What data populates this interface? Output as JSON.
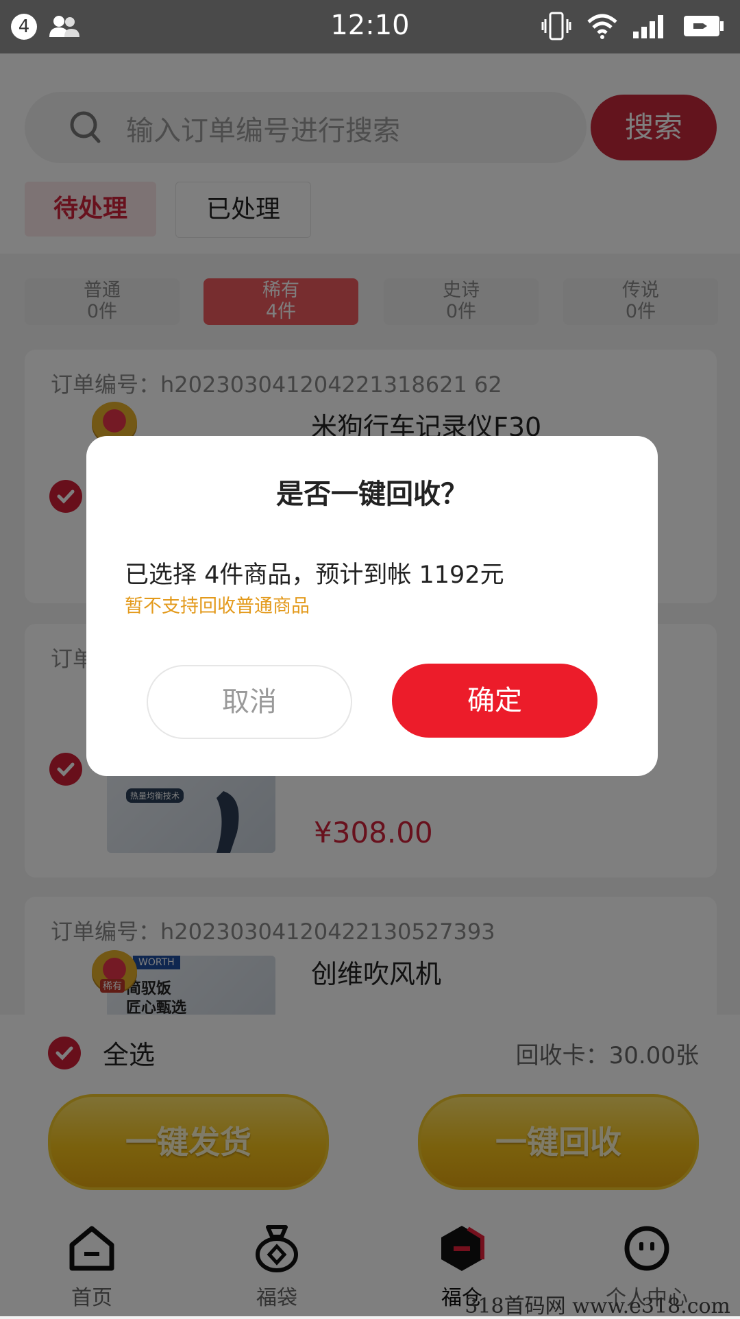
{
  "status_bar": {
    "notification_count": "4",
    "time": "12:10",
    "icons": [
      "users-icon",
      "vibrate-icon",
      "wifi-icon",
      "signal-icon",
      "battery-charging-icon"
    ]
  },
  "search": {
    "placeholder": "输入订单编号进行搜索",
    "button_label": "搜索"
  },
  "tabs": [
    {
      "label": "待处理",
      "active": true
    },
    {
      "label": "已处理",
      "active": false
    }
  ],
  "categories": [
    {
      "name": "普通",
      "count": "0件",
      "active": false
    },
    {
      "name": "稀有",
      "count": "4件",
      "active": true
    },
    {
      "name": "史诗",
      "count": "0件",
      "active": false
    },
    {
      "name": "传说",
      "count": "0件",
      "active": false
    }
  ],
  "orders": [
    {
      "order_label": "订单编号：",
      "order_no": "h202303041204221318621 62",
      "product": "米狗行车记录仪F30"
    },
    {
      "order_label": "订单编号：",
      "price": "¥308.00"
    },
    {
      "order_label": "订单编号：",
      "order_no": "h20230304120422130527393",
      "product": "创维吹风机",
      "badge": "稀有",
      "image_text": [
        "WORTH",
        "简驭饭",
        "匠心甄选"
      ]
    }
  ],
  "partial_texts": {
    "order_label_short": "订单",
    "thumb_caption": "热量均衡技术"
  },
  "bottom_bar": {
    "select_all": "全选",
    "recycle_card": "回收卡：30.00张",
    "ship_button": "一键发货",
    "recycle_button": "一键回收"
  },
  "tab_bar": [
    {
      "label": "首页",
      "icon": "home-icon"
    },
    {
      "label": "福袋",
      "icon": "lucky-bag-icon"
    },
    {
      "label": "福仓",
      "icon": "warehouse-icon",
      "active": true
    },
    {
      "label": "个人中心",
      "icon": "profile-icon"
    }
  ],
  "dialog": {
    "title": "是否一键回收？",
    "message": "已选择 4件商品，预计到帐 1192元",
    "note": "暂不支持回收普通商品",
    "cancel": "取消",
    "confirm": "确定"
  },
  "watermark": "318首码网 www.e318.com",
  "colors": {
    "brand_red": "#c6283b",
    "confirm_red": "#ec1c2a",
    "note_orange": "#e39a1c",
    "gold": "#f5c21a"
  }
}
